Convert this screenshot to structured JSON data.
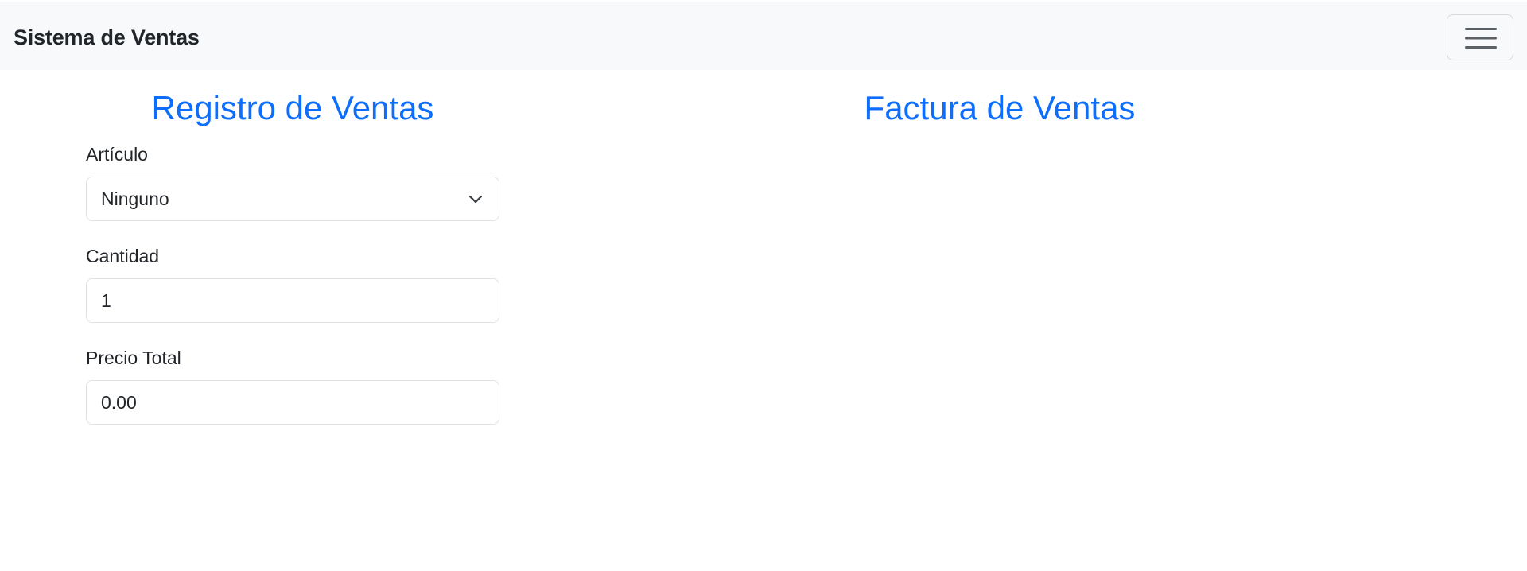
{
  "navbar": {
    "brand": "Sistema de Ventas",
    "toggle_icon": "hamburger-menu-icon"
  },
  "registro": {
    "title": "Registro de Ventas",
    "articulo": {
      "label": "Artículo",
      "selected": "Ninguno",
      "icon": "chevron-down-icon"
    },
    "cantidad": {
      "label": "Cantidad",
      "value": "1"
    },
    "precio_total": {
      "label": "Precio Total",
      "value": "0.00"
    }
  },
  "factura": {
    "title": "Factura de Ventas"
  },
  "colors": {
    "accent": "#0d6efd",
    "navbar_bg": "#f8f9fa",
    "text": "#212529",
    "border": "#dee2e6"
  }
}
